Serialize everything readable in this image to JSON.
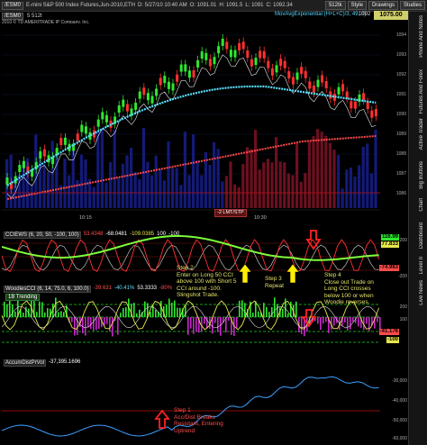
{
  "titlebar": {
    "symbol": "/ESM0",
    "description": "E-mini S&P 500 Index Futures,Jun-2010,ETH",
    "quote": "D: 5/27/10 10:40 AM",
    "open": "O: 1091.01",
    "high": "H: 1091.5",
    "low": "L: 1091",
    "close": "C: 1092.34",
    "buttons": [
      "512tk",
      "Style",
      "Drawings",
      "Studies"
    ]
  },
  "last_price": "1075.00",
  "infobar": {
    "symbol": "/ESM0",
    "interval": "5 512t",
    "ma_label": "MovAvgExponential (H+L+C)/3, 49, 0)",
    "ma_value": "1092",
    "copyright": "2010 © TD AMERITRADE IP Company, Inc."
  },
  "sidebar_tabs": [
    "Phone And Notes",
    "Futures And Forex",
    "Active Trader",
    "Big Buttons",
    "Chart",
    "Dashboard",
    "Level II",
    "Live News"
  ],
  "price_pane": {
    "y_ticks": [
      "1094",
      "1093",
      "1092",
      "1091",
      "1090",
      "1089",
      "1088",
      "1087",
      "1086"
    ],
    "x_labels": [
      "10:15",
      "10:30"
    ],
    "order_tag": "-2 LMT/STP"
  },
  "cci_pane": {
    "label": "CCIEWS (6, 20, 50, -100, 100)",
    "values": [
      "53.4348",
      "-68.0481",
      "-109.0385",
      "100",
      "-100"
    ],
    "y_tags": [
      "116.99",
      "77.833",
      "-74.983"
    ],
    "y_ticks": [
      "200",
      "100",
      "0",
      "-100",
      "-200"
    ]
  },
  "woodie_pane": {
    "label": "WoodiesCCI (6, 14, 75.0, 6, 100.0)",
    "values": [
      "-39.631",
      "-40.41%",
      "53.3333",
      "-80%"
    ],
    "badge": "1B Trending",
    "y_tags": [
      "-41.176",
      "-100"
    ],
    "y_ticks": [
      "200",
      "100",
      "0",
      "-100"
    ]
  },
  "accum_pane": {
    "label": "AccumDistPrVol",
    "value": "-37,395.1696",
    "y_ticks": [
      "-30,000",
      "-40,000",
      "-50,000",
      "-60,000"
    ]
  },
  "annotations": {
    "step1": "Step 1\nAcc/Dist Breaks\nResistant, Entering\nUptrend",
    "step2": "Step 2\nEnter on Long 50 CCI\nabove 100 with Short 5\nCCI around -100.\nSlingshot Trade.",
    "step3": "Step 3\nRepeat",
    "step4": "Step 4\nClose out Trade on\nLong CCI crosses\nbelow 100 or when\nWoodie reverses."
  },
  "colors": {
    "up_bar": "#2ee82e",
    "down_bar": "#ff3030",
    "ema_fast": "#5be1ff",
    "ema_slow": "#ff4a4a",
    "annotation_text": "#e3e36b",
    "step_arrow_red": "#ff2222",
    "step_arrow_yellow": "#ffee00"
  }
}
